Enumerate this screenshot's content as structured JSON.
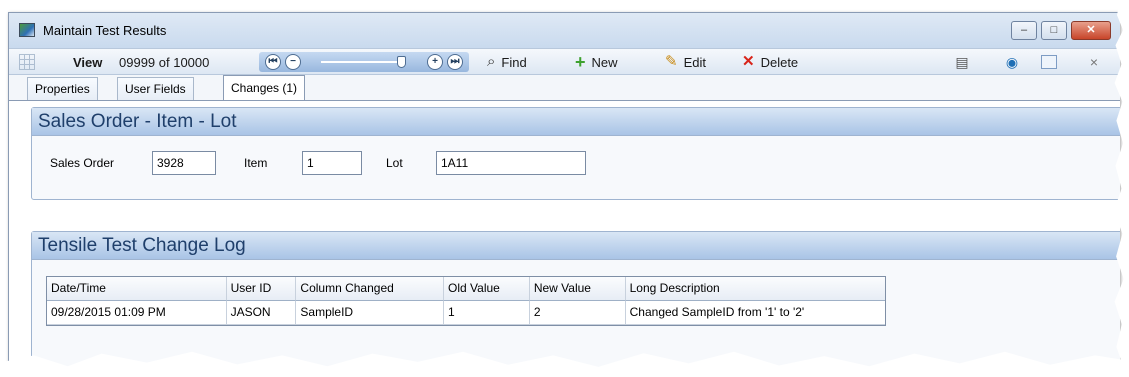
{
  "window": {
    "title": "Maintain Test Results",
    "controls": {
      "minimize": "–",
      "maximize": "□",
      "close": "✕"
    }
  },
  "toolbar": {
    "view_label": "View",
    "record_counter": "09999 of 10000",
    "nav": {
      "first": "⏮",
      "prev": "−",
      "next": "+",
      "last": "⏭"
    },
    "find_label": "Find",
    "new_label": "New",
    "edit_label": "Edit",
    "delete_label": "Delete",
    "close_glyph": "×"
  },
  "tabs": [
    {
      "label": "Properties"
    },
    {
      "label": "User Fields"
    },
    {
      "label": "Changes (1)"
    }
  ],
  "sales_order_group": {
    "title": "Sales Order - Item - Lot",
    "sales_order_label": "Sales Order",
    "sales_order_value": "3928",
    "item_label": "Item",
    "item_value": "1",
    "lot_label": "Lot",
    "lot_value": "1A11"
  },
  "change_log_group": {
    "title": "Tensile Test Change Log",
    "columns": [
      "Date/Time",
      "User ID",
      "Column Changed",
      "Old Value",
      "New Value",
      "Long Description"
    ],
    "rows": [
      [
        "09/28/2015 01:09 PM",
        "JASON",
        "SampleID",
        "1",
        "2",
        "Changed SampleID from '1' to '2'"
      ]
    ]
  }
}
